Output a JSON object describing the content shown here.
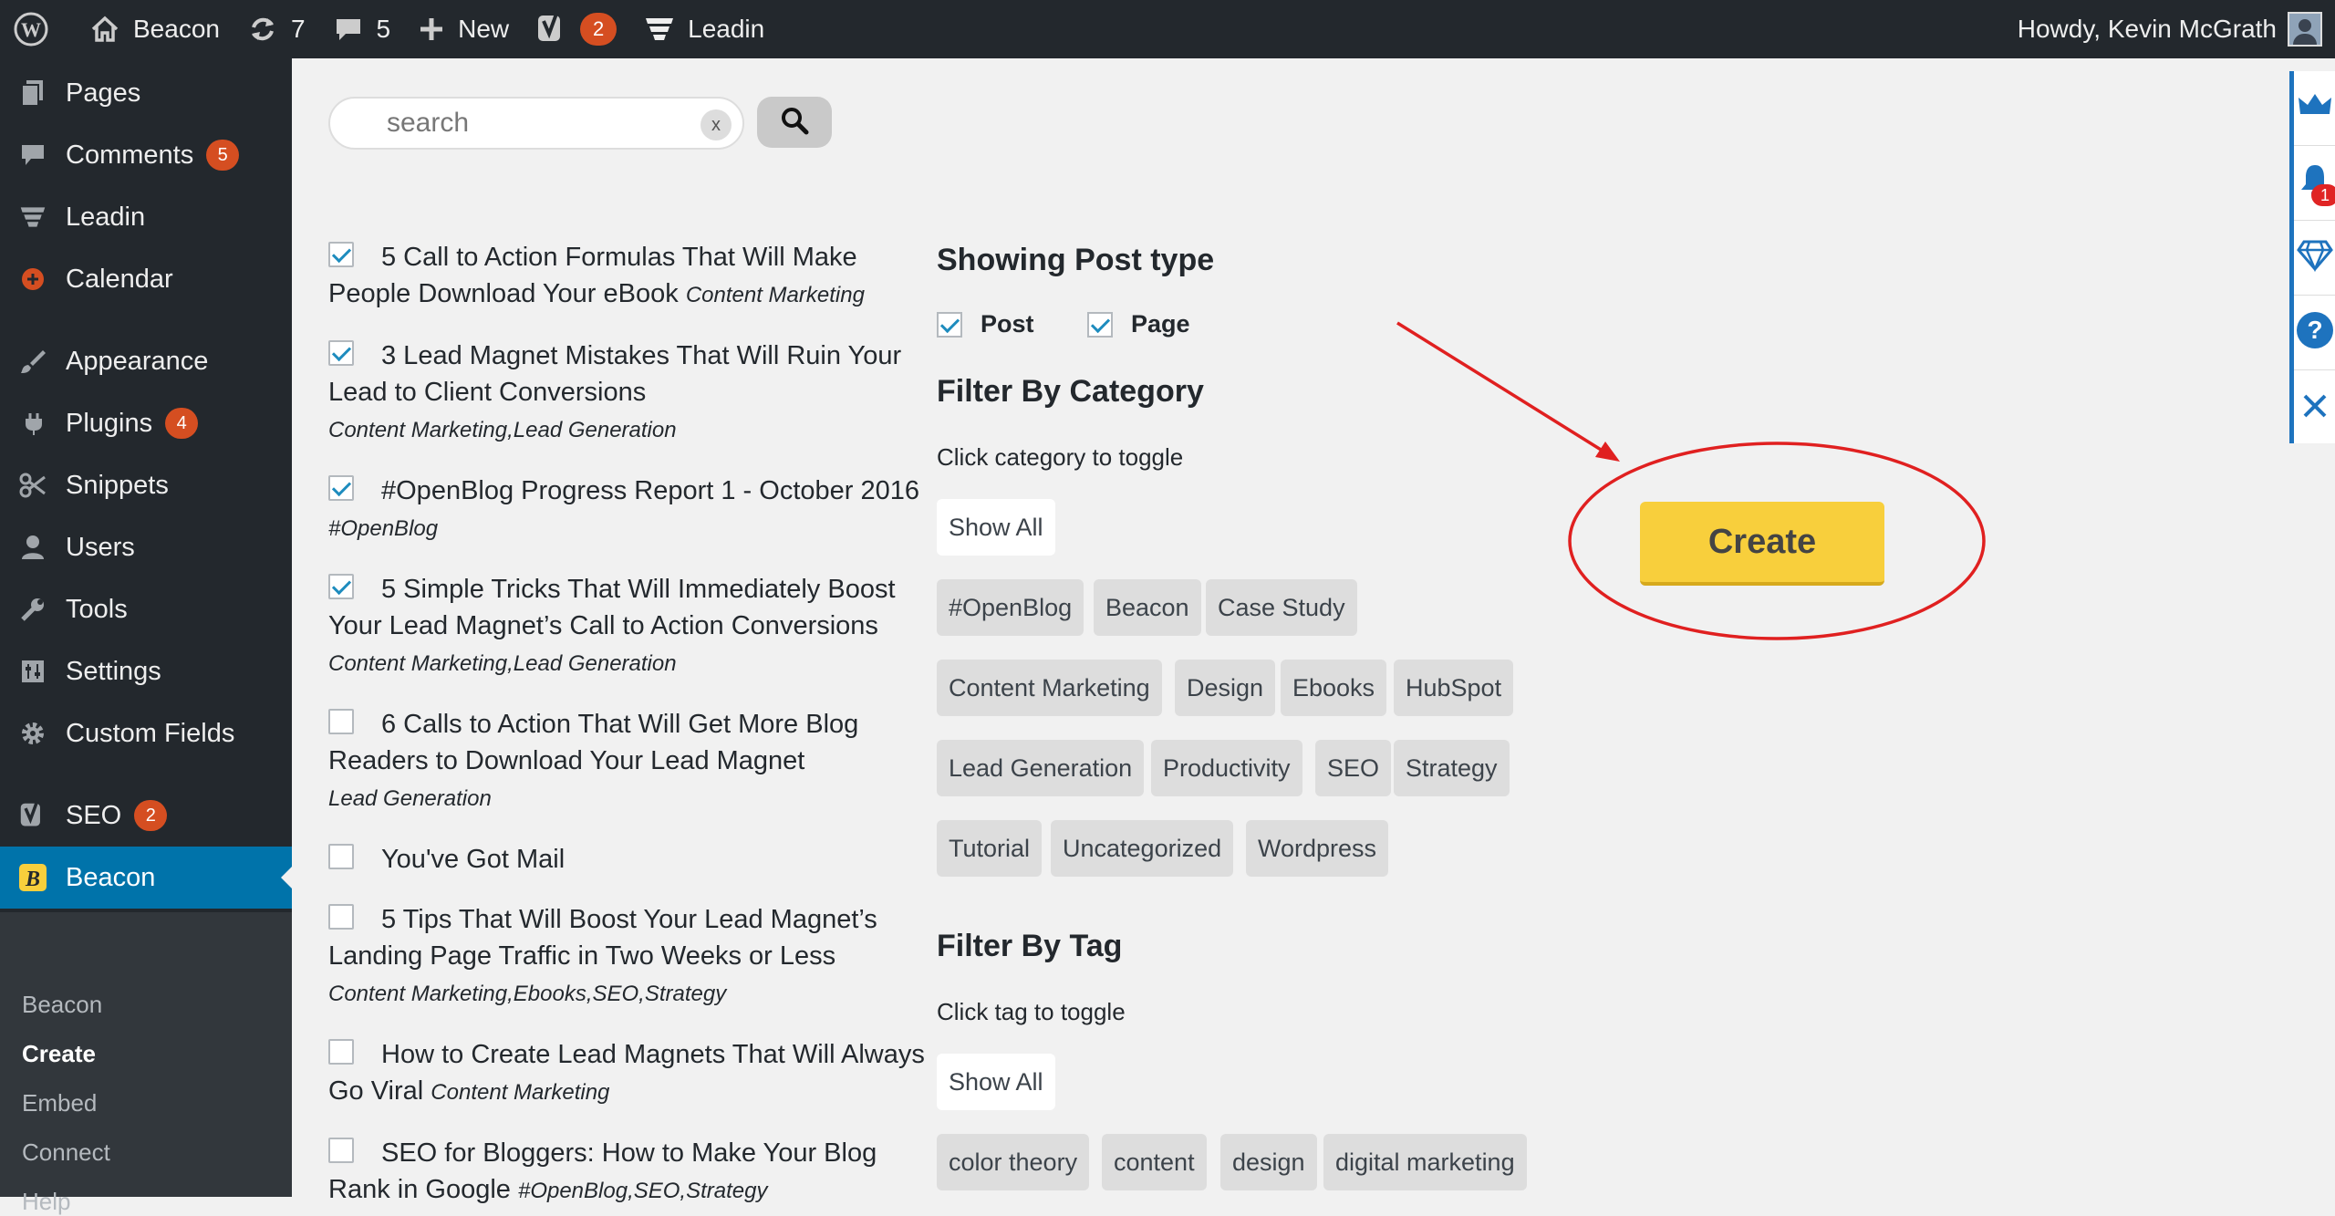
{
  "adminbar": {
    "site_name": "Beacon",
    "updates_count": "7",
    "comments_count": "5",
    "new_label": "New",
    "yoast_count": "2",
    "leadin_label": "Leadin",
    "howdy": "Howdy, Kevin McGrath"
  },
  "sidebar": {
    "items": [
      {
        "label": "Pages",
        "icon": "pages-icon"
      },
      {
        "label": "Comments",
        "badge": "5",
        "icon": "comments-icon"
      },
      {
        "label": "Leadin",
        "icon": "leadin-icon"
      },
      {
        "label": "Calendar",
        "icon": "calendar-icon"
      },
      {
        "label": "Appearance",
        "icon": "appearance-icon"
      },
      {
        "label": "Plugins",
        "badge": "4",
        "icon": "plugins-icon"
      },
      {
        "label": "Snippets",
        "icon": "snippets-icon"
      },
      {
        "label": "Users",
        "icon": "users-icon"
      },
      {
        "label": "Tools",
        "icon": "tools-icon"
      },
      {
        "label": "Settings",
        "icon": "settings-icon"
      },
      {
        "label": "Custom Fields",
        "icon": "gear-icon"
      },
      {
        "label": "SEO",
        "badge": "2",
        "icon": "yoast-icon"
      },
      {
        "label": "Beacon",
        "icon": "beacon-icon"
      }
    ],
    "submenu": [
      "Beacon",
      "Create",
      "Embed",
      "Connect",
      "Help"
    ]
  },
  "search": {
    "placeholder": "search",
    "clear": "x"
  },
  "posts": [
    {
      "title": "5 Call to Action Formulas That Will Make People Download Your eBook",
      "cats": "Content Marketing",
      "checked": true
    },
    {
      "title": "3 Lead Magnet Mistakes That Will Ruin Your Lead to Client Conversions",
      "cats": "Content Marketing,Lead Generation",
      "checked": true
    },
    {
      "title": "#OpenBlog Progress Report 1 - October 2016",
      "cats": "#OpenBlog",
      "checked": true
    },
    {
      "title": "5 Simple Tricks That Will Immediately Boost Your Lead Magnet’s Call to Action Conversions",
      "cats": "Content Marketing,Lead Generation",
      "checked": true
    },
    {
      "title": "6 Calls to Action That Will Get More Blog Readers to Download Your Lead Magnet",
      "cats": "Lead Generation",
      "checked": false
    },
    {
      "title": "You've Got Mail",
      "cats": "",
      "checked": false
    },
    {
      "title": "5 Tips That Will Boost Your Lead Magnet’s Landing Page Traffic in Two Weeks or Less",
      "cats": "Content Marketing,Ebooks,SEO,Strategy",
      "checked": false
    },
    {
      "title": "How to Create Lead Magnets That Will Always Go Viral",
      "cats": "Content Marketing",
      "checked": false
    },
    {
      "title": "SEO for Bloggers: How to Make Your Blog Rank in Google",
      "cats": "#OpenBlog,SEO,Strategy",
      "checked": false
    }
  ],
  "filters": {
    "post_type_heading": "Showing Post type",
    "post_types": [
      "Post",
      "Page"
    ],
    "category_heading": "Filter By Category",
    "category_note": "Click category to toggle",
    "show_all": "Show All",
    "categories": [
      "#OpenBlog",
      "Beacon",
      "Case Study",
      "Content Marketing",
      "Design",
      "Ebooks",
      "HubSpot",
      "Lead Generation",
      "Productivity",
      "SEO",
      "Strategy",
      "Tutorial",
      "Uncategorized",
      "Wordpress"
    ],
    "tag_heading": "Filter By Tag",
    "tag_note": "Click tag to toggle",
    "tags": [
      "color theory",
      "content",
      "design",
      "digital marketing"
    ]
  },
  "create_label": "Create",
  "floatbar": {
    "notification_count": "1",
    "icons": [
      "crown-icon",
      "bell-icon",
      "diamond-icon",
      "help-icon",
      "close-icon"
    ]
  },
  "colors": {
    "accent": "#0073aa",
    "admin_bg": "#23282d",
    "create_btn": "#f8cf3c",
    "annotation": "#e02020"
  }
}
